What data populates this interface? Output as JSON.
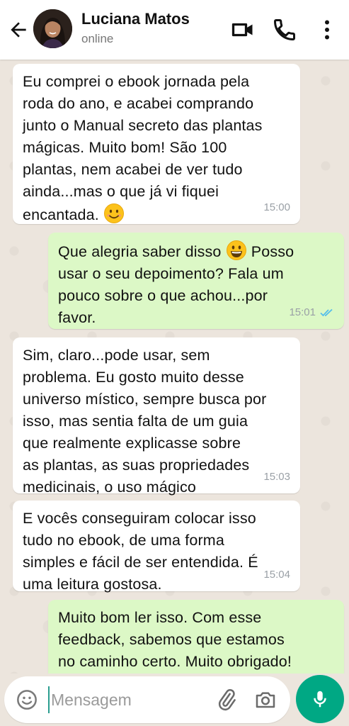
{
  "header": {
    "contact_name": "Luciana Matos",
    "status": "online",
    "back_icon": "arrow-left-icon",
    "video_icon": "video-call-icon",
    "phone_icon": "phone-icon",
    "menu_icon": "more-vertical-icon"
  },
  "messages": [
    {
      "direction": "incoming",
      "text": "Eu comprei o ebook jornada pela\nroda do ano, e acabei comprando\njunto o Manual secreto das plantas\nmágicas. Muito bom! São 100\nplantas, nem acabei de ver tudo\nainda...mas o que já vi fiquei\nencantada.",
      "emoji": "smiling-face-emoji",
      "time": "15:00"
    },
    {
      "direction": "outgoing",
      "text_before_emoji": "Que alegria saber disso",
      "emoji": "grinning-face-emoji",
      "text_after_emoji": "Posso\nusar o seu depoimento? Fala um\npouco sobre o que achou...por\nfavor.",
      "time": "15:01",
      "status_icon": "double-check-read-icon"
    },
    {
      "direction": "incoming",
      "text": "Sim, claro...pode usar, sem\nproblema. Eu gosto muito desse\nuniverso místico, sempre busca por\nisso, mas sentia falta de um guia\nque realmente explicasse sobre\nas plantas, as suas propriedades\nmedicinais, o uso mágico",
      "time": "15:03"
    },
    {
      "direction": "incoming",
      "text": "E vocês conseguiram colocar isso\ntudo no ebook, de uma forma\nsimples e fácil de ser entendida. É\numa leitura gostosa.",
      "time": "15:04"
    },
    {
      "direction": "outgoing",
      "text": "Muito bom ler isso. Com esse\nfeedback, sabemos que estamos\nno caminho certo. Muito obrigado!",
      "time": ""
    }
  ],
  "composer": {
    "placeholder": "Mensagem",
    "emoji_icon": "emoji-icon",
    "attach_icon": "paperclip-icon",
    "camera_icon": "camera-icon",
    "mic_icon": "microphone-icon"
  },
  "colors": {
    "incoming_bubble": "#ffffff",
    "outgoing_bubble": "#dcf8c6",
    "accent": "#00a884",
    "read_check": "#53bdeb"
  }
}
